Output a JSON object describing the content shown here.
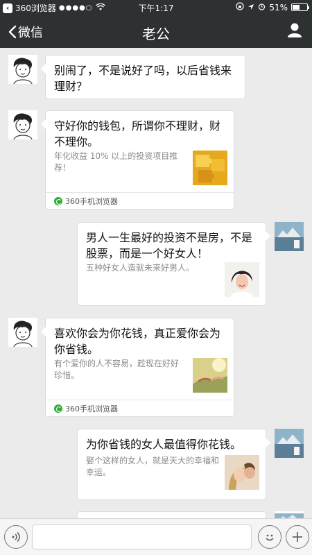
{
  "status_bar": {
    "carrier": "360浏览器",
    "signal": "●●●●○",
    "time": "下午1:17",
    "battery_text": "51%",
    "battery_level": 0.51
  },
  "nav": {
    "back_label": "微信",
    "title": "老公"
  },
  "messages": [
    {
      "side": "left",
      "type": "text",
      "text": "别闹了，不是说好了吗，以后省钱来理财？"
    },
    {
      "side": "left",
      "type": "card",
      "title": "守好你的钱包，所谓你不理财，财不理你。",
      "description": "年化收益 10% 以上的投资项目推荐！",
      "thumbnail": "puzzle-gold",
      "source": "360手机浏览器"
    },
    {
      "side": "right",
      "type": "card",
      "title": "男人一生最好的投资不是房，不是股票，而是一个好女人！",
      "description": "五种好女人造就未来好男人。",
      "thumbnail": "woman-portrait"
    },
    {
      "side": "left",
      "type": "card",
      "title": "喜欢你会为你花钱，真正爱你会为你省钱。",
      "description": "有个爱你的人不容易，趁现在好好珍惜。",
      "thumbnail": "holding-hands",
      "source": "360手机浏览器"
    },
    {
      "side": "right",
      "type": "card",
      "title": "为你省钱的女人最值得你花钱。",
      "description": "娶个这样的女人，就是天大的幸福和幸运。",
      "thumbnail": "couple-hug"
    }
  ],
  "input_bar": {
    "voice_icon": "voice-icon",
    "emoji_icon": "emoji-icon",
    "plus_icon": "plus-icon"
  },
  "colors": {
    "header": "#2e3132",
    "background": "#ebebeb",
    "source_icon": "#2fae3c"
  }
}
